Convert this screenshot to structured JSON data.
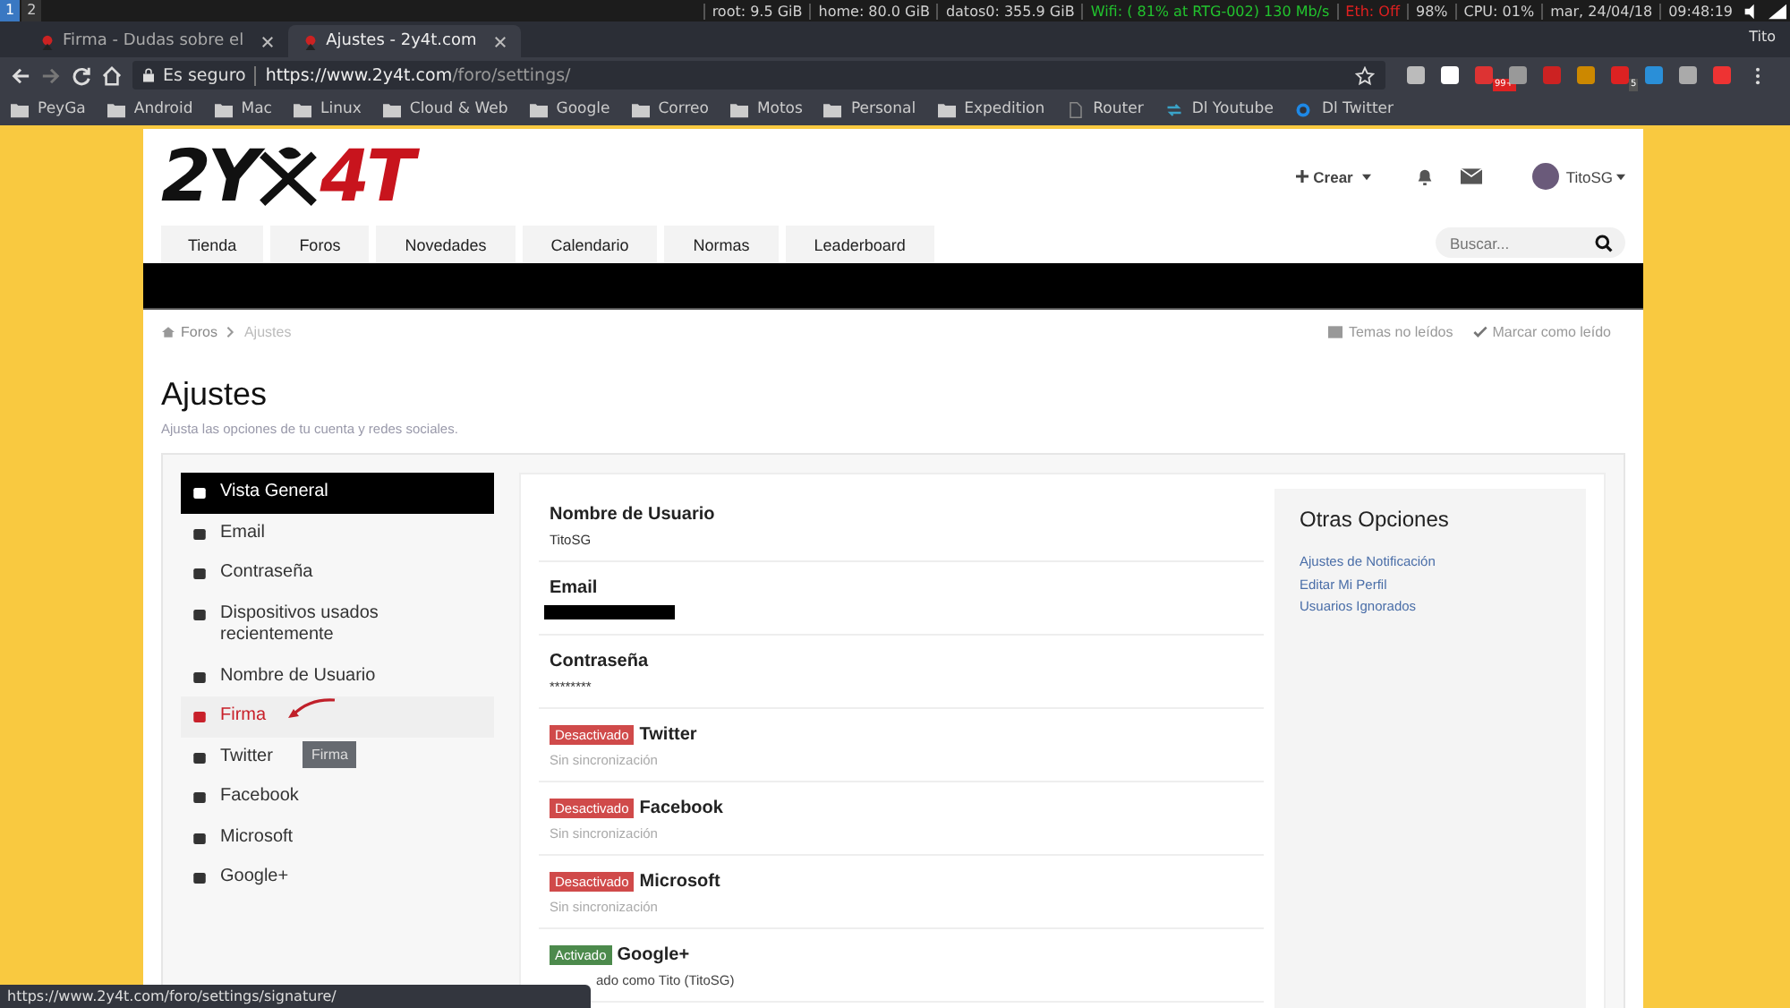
{
  "os_bar": {
    "workspaces": [
      {
        "label": "1",
        "selected": true
      },
      {
        "label": "2",
        "selected": false
      }
    ],
    "status": [
      {
        "text": "root: 9.5 GiB",
        "color": "#d0d0d0"
      },
      {
        "text": "home: 80.0 GiB",
        "color": "#d0d0d0"
      },
      {
        "text": "datos0: 355.9 GiB",
        "color": "#d0d0d0"
      },
      {
        "text": "Wifi: ( 81% at RTG-002) 130 Mb/s",
        "color": "#22c32e"
      },
      {
        "text": "Eth: Off",
        "color": "#e02020"
      },
      {
        "text": "98%",
        "color": "#d0d0d0"
      },
      {
        "text": "CPU: 01%",
        "color": "#d0d0d0"
      },
      {
        "text": "mar, 24/04/18",
        "color": "#d0d0d0"
      },
      {
        "text": "09:48:19",
        "color": "#d0d0d0"
      }
    ]
  },
  "browser": {
    "tabs": [
      {
        "title": "Firma - Dudas sobre el",
        "selected": false
      },
      {
        "title": "Ajustes - 2y4t.com",
        "selected": true
      }
    ],
    "profile": "Tito",
    "security": "Es seguro",
    "url_scheme": "https://",
    "url_host": "www.2y4t.com",
    "url_path": "/foro/settings/",
    "badges": [
      "99+",
      "5"
    ],
    "bookmarks": [
      {
        "label": "PeyGa",
        "kind": "folder"
      },
      {
        "label": "Android",
        "kind": "folder"
      },
      {
        "label": "Mac",
        "kind": "folder"
      },
      {
        "label": "Linux",
        "kind": "folder"
      },
      {
        "label": "Cloud & Web",
        "kind": "folder"
      },
      {
        "label": "Google",
        "kind": "folder"
      },
      {
        "label": "Correo",
        "kind": "folder"
      },
      {
        "label": "Motos",
        "kind": "folder"
      },
      {
        "label": "Personal",
        "kind": "folder"
      },
      {
        "label": "Expedition",
        "kind": "folder"
      },
      {
        "label": "Router",
        "kind": "page"
      },
      {
        "label": "Dl Youtube",
        "kind": "sync"
      },
      {
        "label": "Dl Twitter",
        "kind": "ring"
      }
    ],
    "status_url": "https://www.2y4t.com/foro/settings/signature/"
  },
  "site": {
    "logo_left": "2Y",
    "logo_right": "4T",
    "create": "Crear",
    "user": "TitoSG",
    "nav": [
      "Tienda",
      "Foros",
      "Novedades",
      "Calendario",
      "Normas",
      "Leaderboard"
    ],
    "search": {
      "placeholder": "Buscar..."
    },
    "breadcrumb": [
      "Foros",
      "Ajustes"
    ],
    "actions": [
      "Temas no leídos",
      "Marcar como leído"
    ],
    "title": "Ajustes",
    "subtitle": "Ajusta las opciones de tu cuenta y redes sociales.",
    "sidebar": [
      {
        "label": "Vista General",
        "selected": true,
        "hovered": false
      },
      {
        "label": "Email",
        "selected": false,
        "hovered": false
      },
      {
        "label": "Contraseña",
        "selected": false,
        "hovered": false
      },
      {
        "label": "Dispositivos usados recientemente",
        "selected": false,
        "hovered": false
      },
      {
        "label": "Nombre de Usuario",
        "selected": false,
        "hovered": false
      },
      {
        "label": "Firma",
        "selected": false,
        "hovered": true
      },
      {
        "label": "Twitter",
        "selected": false,
        "hovered": false
      },
      {
        "label": "Facebook",
        "selected": false,
        "hovered": false
      },
      {
        "label": "Microsoft",
        "selected": false,
        "hovered": false
      },
      {
        "label": "Google+",
        "selected": false,
        "hovered": false
      }
    ],
    "tooltip": "Firma",
    "rows": [
      {
        "kind": "field",
        "label": "Nombre de Usuario",
        "value": "TitoSG"
      },
      {
        "kind": "redacted",
        "label": "Email"
      },
      {
        "kind": "field",
        "label": "Contraseña",
        "value": "********"
      },
      {
        "kind": "social",
        "badge": "Desactivado",
        "active": false,
        "label": "Twitter",
        "value": "Sin sincronización"
      },
      {
        "kind": "social",
        "badge": "Desactivado",
        "active": false,
        "label": "Facebook",
        "value": "Sin sincronización"
      },
      {
        "kind": "social",
        "badge": "Desactivado",
        "active": false,
        "label": "Microsoft",
        "value": "Sin sincronización"
      },
      {
        "kind": "social",
        "badge": "Activado",
        "active": true,
        "label": "Google+",
        "value": "ado como Tito (TitoSG)"
      }
    ],
    "other": {
      "title": "Otras Opciones",
      "links": [
        "Ajustes de Notificación",
        "Editar Mi Perfil",
        "Usuarios Ignorados"
      ]
    }
  }
}
